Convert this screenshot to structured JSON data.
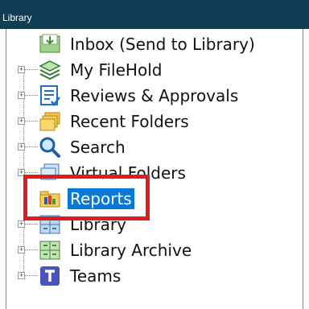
{
  "panel": {
    "title": "Library"
  },
  "tree": {
    "items": [
      {
        "label": "Inbox (Send to Library)",
        "icon": "inbox-icon",
        "expandable": false,
        "selected": false
      },
      {
        "label": "My FileHold",
        "icon": "layers-icon",
        "expandable": true,
        "selected": false
      },
      {
        "label": "Reviews & Approvals",
        "icon": "checklist-icon",
        "expandable": true,
        "selected": false
      },
      {
        "label": "Recent Folders",
        "icon": "folders-icon",
        "expandable": true,
        "selected": false
      },
      {
        "label": "Search",
        "icon": "search-icon",
        "expandable": true,
        "selected": false
      },
      {
        "label": "Virtual Folders",
        "icon": "virtual-folder-icon",
        "expandable": true,
        "selected": false
      },
      {
        "label": "Reports",
        "icon": "reports-icon",
        "expandable": false,
        "selected": true
      },
      {
        "label": "Library",
        "icon": "cabinet-icon",
        "expandable": true,
        "selected": false
      },
      {
        "label": "Library Archive",
        "icon": "archive-cabinet-icon",
        "expandable": true,
        "selected": false
      },
      {
        "label": "Teams",
        "icon": "teams-icon",
        "expandable": true,
        "selected": false
      }
    ]
  },
  "colors": {
    "header_bg": "#0f3d55",
    "selection_bg": "#0a78d7",
    "annotation_box": "#e01b1b"
  }
}
